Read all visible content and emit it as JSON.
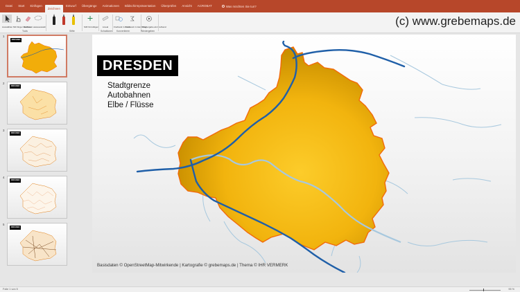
{
  "ribbon_tabs": [
    "Datei",
    "Start",
    "Einfügen",
    "Zeichnen",
    "Entwurf",
    "Übergänge",
    "Animationen",
    "Bildschirmpräsentation",
    "Überprüfen",
    "Ansicht",
    "ACROBAT"
  ],
  "active_tab": "Zeichnen",
  "tell_me": "Was möchten Sie tun?",
  "watermark": "(c) www.grebemaps.de",
  "ribbon": {
    "auswaehlen": "Auswählen",
    "mit_finger": "Mit Finger zeichnen",
    "radierer": "Radierer",
    "lassoauswahl": "Lassoauswahl",
    "tools_label": "Tools",
    "stifte_label": "Stifte",
    "stift_hinzufuegen": "Stift hinzufügen",
    "lineal": "Lineal",
    "schablonen_label": "Schablonen",
    "freihand_form": "Freihand in Form",
    "freihand_gleichung": "Freihand in Gleichung",
    "konvertieren_label": "Konvertieren",
    "wiedergabe": "Wiedergabe als Freihand",
    "wiedergabe_label": "Wiedergeben",
    "pen_colors": [
      "#222222",
      "#c0392b",
      "#e8c000"
    ]
  },
  "slides": [
    {
      "num": "1",
      "title": "DRESDEN",
      "selected": true
    },
    {
      "num": "2",
      "title": "DRESDEN",
      "selected": false
    },
    {
      "num": "3",
      "title": "DRESDEN",
      "selected": false
    },
    {
      "num": "4",
      "title": "DRESDEN",
      "selected": false
    },
    {
      "num": "5",
      "title": "DRESDEN",
      "selected": false
    }
  ],
  "slide": {
    "title": "DRESDEN",
    "legend": [
      "Stadtgrenze",
      "Autobahnen",
      "Elbe / Flüsse"
    ],
    "credit": "Basisdaten © OpenStreetMap-Mitwirkende | Kartografie © grebemaps.de | Thema © IHR VERMERK"
  },
  "colors": {
    "accent": "#b7472a",
    "map_fill_light": "#fcc21a",
    "map_fill_dark": "#c98f00",
    "border": "#f26a0a",
    "autobahn": "#1f5fa8",
    "river": "#a7c8de"
  },
  "status": {
    "slide_info": "Folie 1 von 5",
    "zoom": "95 %"
  }
}
